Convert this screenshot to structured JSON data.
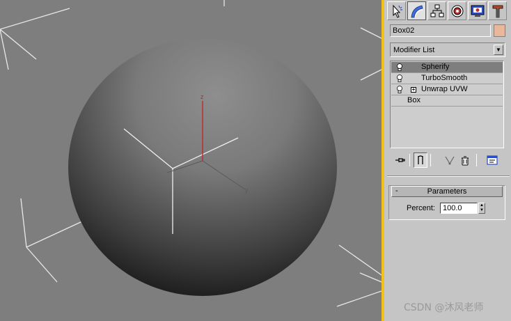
{
  "viewport": {
    "axis_z_label": "z",
    "axis_y_label": "y"
  },
  "command_panel": {
    "tabs": [
      {
        "name": "create-icon"
      },
      {
        "name": "modify-icon"
      },
      {
        "name": "hierarchy-icon"
      },
      {
        "name": "motion-icon"
      },
      {
        "name": "display-icon"
      },
      {
        "name": "utilities-icon"
      }
    ],
    "object_name": "Box02",
    "object_color": "#e9b89c",
    "modifier_list_label": "Modifier List",
    "modifier_stack": [
      {
        "label": "Spherify",
        "selected": true,
        "bulb": true,
        "expandable": false
      },
      {
        "label": "TurboSmooth",
        "selected": false,
        "bulb": true,
        "expandable": false
      },
      {
        "label": "Unwrap UVW",
        "selected": false,
        "bulb": true,
        "expandable": true
      },
      {
        "label": "Box",
        "selected": false,
        "bulb": false,
        "expandable": false
      }
    ],
    "stack_tools": [
      {
        "name": "pin-stack-icon"
      },
      {
        "name": "show-end-result-icon"
      },
      {
        "name": "make-unique-icon"
      },
      {
        "name": "remove-modifier-icon"
      },
      {
        "name": "configure-modifier-sets-icon"
      }
    ],
    "rollout": {
      "toggle": "-",
      "title": "Parameters",
      "percent_label": "Percent:",
      "percent_value": "100.0"
    }
  },
  "watermark": "CSDN @沐风老师",
  "colors": {
    "panel_bg": "#c5c5c5",
    "viewport_bg": "#7e7e7e",
    "separator": "#f2c21b",
    "axis_z": "#cc1e1e"
  }
}
